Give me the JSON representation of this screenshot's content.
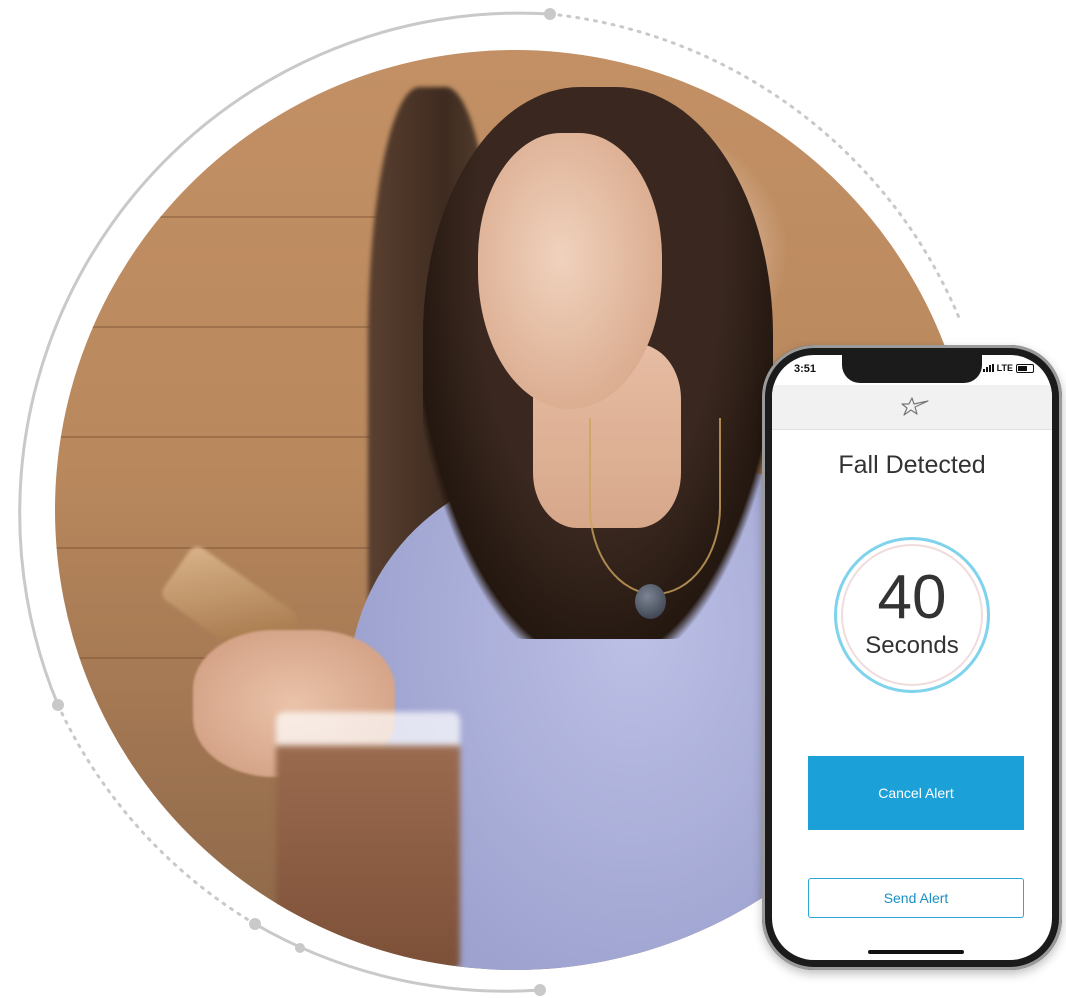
{
  "status_bar": {
    "time": "3:51",
    "network": "LTE"
  },
  "app": {
    "logo_icon": "shooting-star-icon"
  },
  "alert": {
    "title": "Fall Detected",
    "countdown_value": "40",
    "countdown_unit": "Seconds",
    "cancel_label": "Cancel Alert",
    "send_label": "Send Alert"
  },
  "colors": {
    "primary": "#1ba1d8",
    "ring": "#7fd3ec",
    "text": "#333333"
  }
}
